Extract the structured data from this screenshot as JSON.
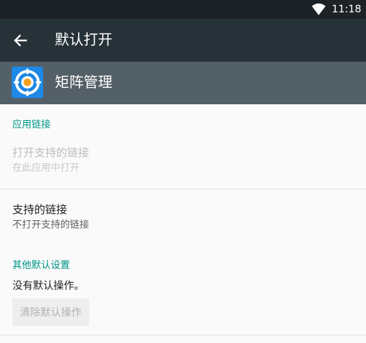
{
  "status_bar": {
    "time": "11:18",
    "wifi_icon": "wifi-icon"
  },
  "app_bar": {
    "back_icon": "arrow-back-icon",
    "title": "默认打开"
  },
  "app_header": {
    "app_icon": "target-icon",
    "app_name": "矩阵管理"
  },
  "app_links": {
    "section_title": "应用链接",
    "open_supported_links": {
      "title": "打开支持的链接",
      "summary": "在此应用中打开"
    },
    "supported_links": {
      "title": "支持的链接",
      "summary": "不打开支持的链接"
    }
  },
  "other_defaults": {
    "section_title": "其他默认设置",
    "status_text": "没有默认操作。",
    "clear_button_label": "清除默认操作"
  },
  "colors": {
    "status_bar": "#1c2226",
    "app_bar": "#263238",
    "app_header": "#546067",
    "accent": "#009688",
    "app_icon_blue": "#1e88e5"
  }
}
